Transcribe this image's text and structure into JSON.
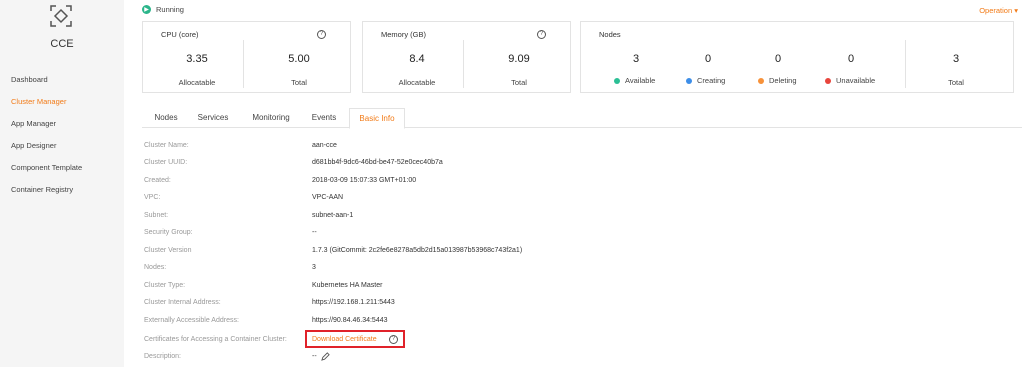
{
  "app": {
    "name": "CCE"
  },
  "sidebar": {
    "items": [
      {
        "label": "Dashboard"
      },
      {
        "label": "Cluster Manager"
      },
      {
        "label": "App Manager"
      },
      {
        "label": "App Designer"
      },
      {
        "label": "Component Template"
      },
      {
        "label": "Container Registry"
      }
    ]
  },
  "header": {
    "status": "Running",
    "operation": "Operation ▾"
  },
  "cpu": {
    "title": "CPU (core)",
    "allocatable_value": "3.35",
    "allocatable_label": "Allocatable",
    "total_value": "5.00",
    "total_label": "Total"
  },
  "memory": {
    "title": "Memory (GB)",
    "allocatable_value": "8.4",
    "allocatable_label": "Allocatable",
    "total_value": "9.09",
    "total_label": "Total"
  },
  "nodes": {
    "title": "Nodes",
    "available": {
      "value": "3",
      "label": "Available",
      "color": "#2bbf95"
    },
    "creating": {
      "value": "0",
      "label": "Creating",
      "color": "#3d8ee8"
    },
    "deleting": {
      "value": "0",
      "label": "Deleting",
      "color": "#f7923a"
    },
    "unavailable": {
      "value": "0",
      "label": "Unavailable",
      "color": "#e8453c"
    },
    "total": {
      "value": "3",
      "label": "Total"
    }
  },
  "tabs": [
    {
      "label": "Nodes"
    },
    {
      "label": "Services"
    },
    {
      "label": "Monitoring"
    },
    {
      "label": "Events"
    },
    {
      "label": "Basic Info",
      "active": true
    }
  ],
  "info": {
    "cluster_name": {
      "label": "Cluster Name:",
      "value": "aan-cce"
    },
    "cluster_uuid": {
      "label": "Cluster UUID:",
      "value": "d681bb4f-9dc6-46bd-be47-52e0cec40b7a"
    },
    "created": {
      "label": "Created:",
      "value": "2018-03-09 15:07:33 GMT+01:00"
    },
    "vpc": {
      "label": "VPC:",
      "value": "VPC-AAN"
    },
    "subnet": {
      "label": "Subnet:",
      "value": "subnet-aan-1"
    },
    "security_group": {
      "label": "Security Group:",
      "value": "--"
    },
    "cluster_version": {
      "label": "Cluster Version",
      "value": "1.7.3 (GitCommit: 2c2fe6e8278a5db2d15a013987b53968c743f2a1)"
    },
    "nodes": {
      "label": "Nodes:",
      "value": "3"
    },
    "cluster_type": {
      "label": "Cluster Type:",
      "value": "Kubernetes HA Master"
    },
    "internal_address": {
      "label": "Cluster Internal Address:",
      "value": "https://192.168.1.211:5443"
    },
    "external_address": {
      "label": "Externally Accessible Address:",
      "value": "https://90.84.46.34:5443"
    },
    "certificates": {
      "label": "Certificates for Accessing a Container Cluster:",
      "link": "Download Certificate"
    },
    "description": {
      "label": "Description:",
      "value": "--"
    }
  },
  "colors": {
    "accent": "#f27b18",
    "highlight_border": "#e0222a",
    "running": "#2bb58a"
  }
}
